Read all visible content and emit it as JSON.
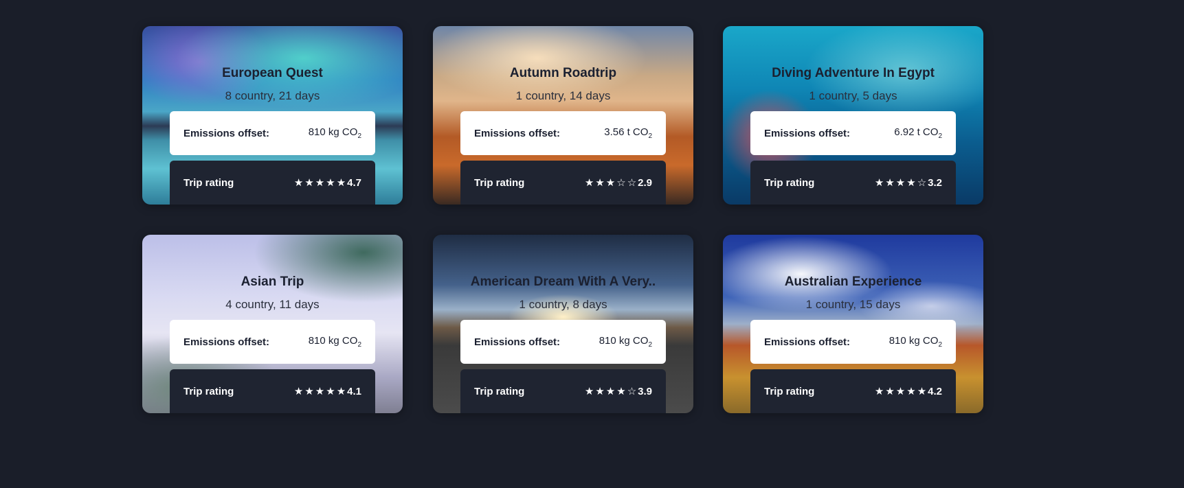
{
  "labels": {
    "emissions": "Emissions offset:",
    "rating": "Trip rating",
    "co2_sub": "2",
    "star_full": "★",
    "star_empty": "☆"
  },
  "trips": [
    {
      "title": "European Quest",
      "subtitle": "8 country, 21 days",
      "emissions": "810 kg CO",
      "rating": "4.7",
      "stars_filled": 5
    },
    {
      "title": "Autumn Roadtrip",
      "subtitle": "1 country, 14 days",
      "emissions": "3.56 t CO",
      "rating": "2.9",
      "stars_filled": 3
    },
    {
      "title": "Diving Adventure In Egypt",
      "subtitle": "1 country, 5 days",
      "emissions": "6.92 t CO",
      "rating": "3.2",
      "stars_filled": 4
    },
    {
      "title": "Asian Trip",
      "subtitle": "4 country, 11 days",
      "emissions": "810 kg CO",
      "rating": "4.1",
      "stars_filled": 5
    },
    {
      "title": "American Dream With A Very..",
      "subtitle": "1 country, 8 days",
      "emissions": "810 kg CO",
      "rating": "3.9",
      "stars_filled": 4
    },
    {
      "title": "Australian Experience",
      "subtitle": "1 country, 15 days",
      "emissions": "810 kg CO",
      "rating": "4.2",
      "stars_filled": 5
    }
  ]
}
